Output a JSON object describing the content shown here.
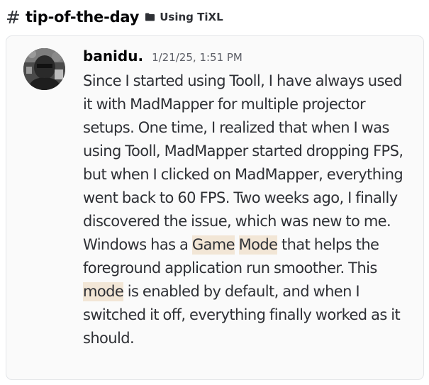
{
  "header": {
    "hash": "#",
    "channel": "tip-of-the-day",
    "folder_icon": "folder-icon",
    "category": "Using TiXL"
  },
  "message": {
    "username": "banidu.",
    "timestamp": "1/21/25, 1:51 PM",
    "body": {
      "part1": "Since I started using Tooll, I have always used it with MadMapper for multiple projector setups. One time, I realized that when I was using Tooll, MadMapper started dropping FPS, but when I clicked on MadMapper, everything went back to 60 FPS. Two weeks ago, I finally discovered the issue, which was new to me. Windows has a ",
      "hl1": "Game",
      "space1": " ",
      "hl2": "Mode",
      "part2": " that helps the foreground application run smoother. This ",
      "hl3": "mode",
      "part3": " is enabled by default, and when I switched it off, everything finally worked as it should."
    }
  },
  "colors": {
    "highlight": "#f2e6d6",
    "card_border": "#e3e5e8",
    "text": "#2e3035"
  }
}
